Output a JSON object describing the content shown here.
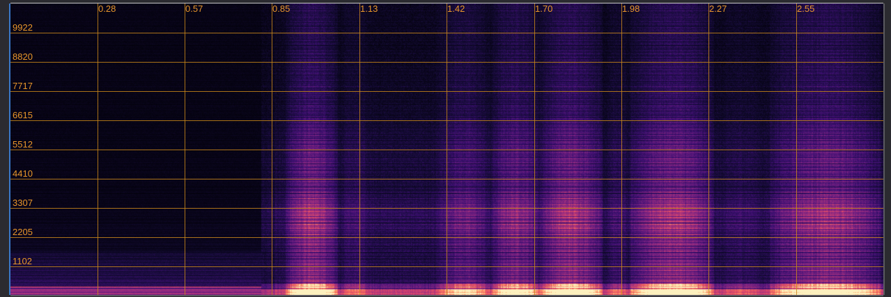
{
  "spectrogram": {
    "time_labels": [
      "0.28",
      "0.57",
      "0.85",
      "1.13",
      "1.42",
      "1.70",
      "1.98",
      "2.27",
      "2.55"
    ],
    "freq_labels": [
      "9922",
      "8820",
      "7717",
      "6615",
      "5512",
      "4410",
      "3307",
      "2205",
      "1102"
    ],
    "colors": {
      "grid": "#c8861a",
      "label": "#e8962a",
      "background": "#000000",
      "frame_accent": "#3a78c8"
    },
    "colormap": "magma"
  }
}
